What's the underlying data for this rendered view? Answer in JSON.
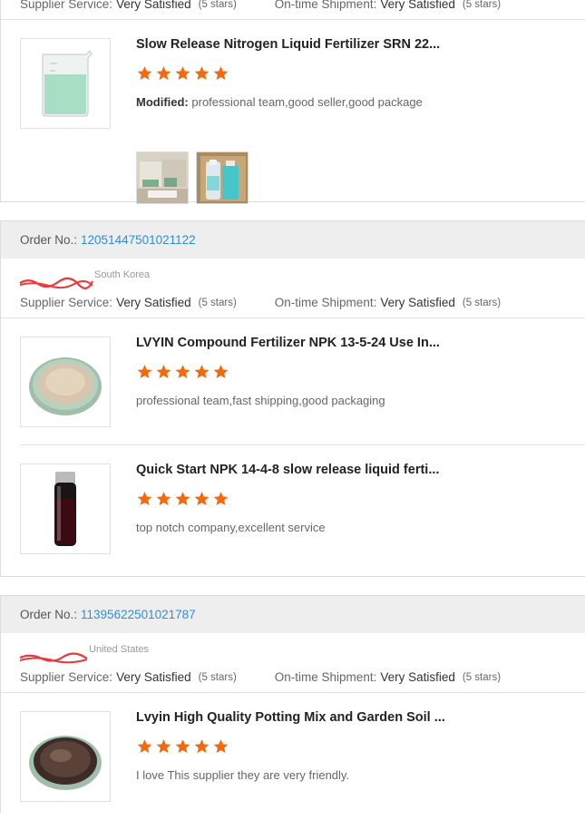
{
  "colors": {
    "link": "#2d8fd5",
    "star": "#f26a10"
  },
  "labels": {
    "order_no": "Order No.:",
    "supplier_service": "Supplier Service:",
    "ontime_shipment": "On-time Shipment:",
    "rating_text": "Very Satisfied",
    "stars_text": "(5 stars)",
    "modified": "Modified:"
  },
  "top_card": {
    "product": {
      "title": "Slow Release Nitrogen Liquid Fertilizer SRN 22...",
      "rating": 5,
      "comment": "professional team,good seller,good package"
    }
  },
  "orders": [
    {
      "order_no": "12051447501021122",
      "buyer_country": "South Korea",
      "products": [
        {
          "title": "LVYIN Compound Fertilizer NPK 13-5-24 Use In...",
          "rating": 5,
          "comment": "professional team,fast shipping,good packaging"
        },
        {
          "title": "Quick Start NPK 14-4-8 slow release liquid ferti...",
          "rating": 5,
          "comment": "top notch company,excellent service"
        }
      ]
    },
    {
      "order_no": "11395622501021787",
      "buyer_country": "United States",
      "products": [
        {
          "title": "Lvyin High Quality Potting Mix and Garden Soil ...",
          "rating": 5,
          "comment": "I love This supplier they are very friendly."
        }
      ]
    }
  ]
}
